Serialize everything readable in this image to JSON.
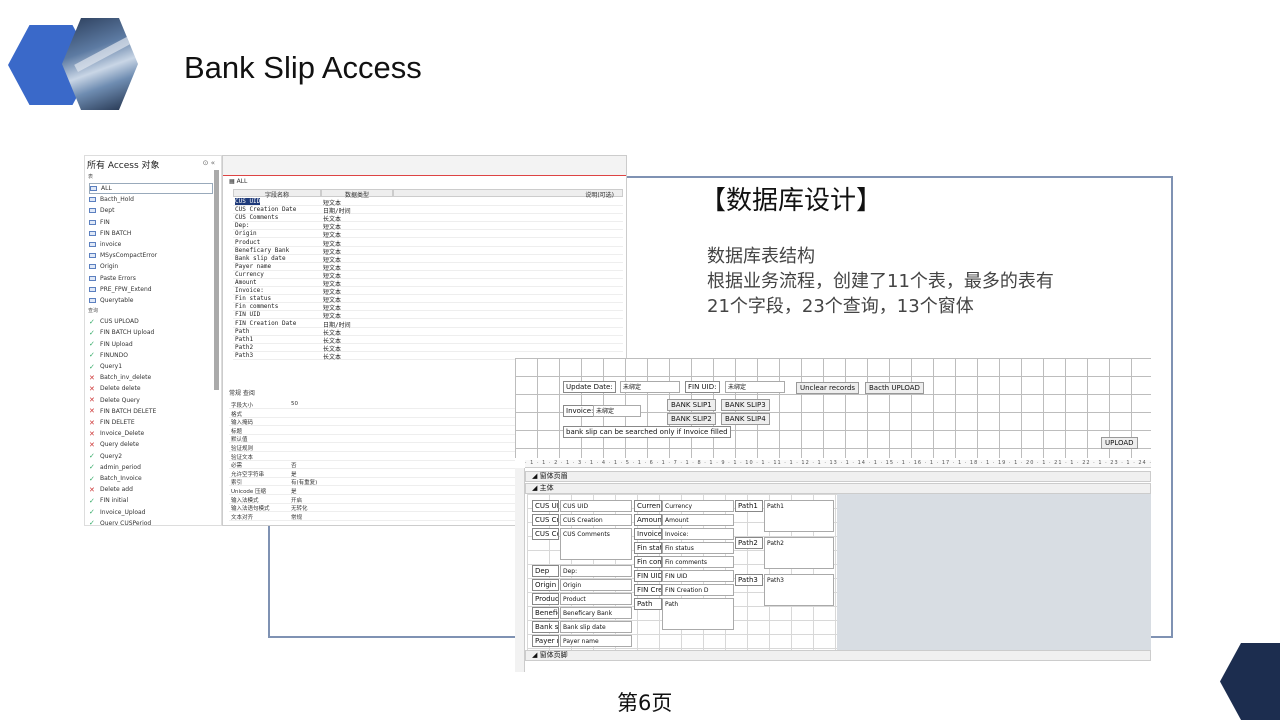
{
  "header": {
    "title": "Bank Slip Access"
  },
  "content": {
    "heading": "【数据库设计】",
    "desc_line1": "数据库表结构",
    "desc_line2": "根据业务流程，创建了11个表，最多的表有",
    "desc_line3": "21个字段，23个查询，13个窗体"
  },
  "nav": {
    "title": "所有 Access 对象",
    "tables_section": "表",
    "queries_section": "查询",
    "tables": [
      "ALL",
      "Bacth_Hold",
      "Dept",
      "FIN",
      "FIN BATCH",
      "invoice",
      "MSysCompactError",
      "Origin",
      "Paste Errors",
      "PRE_FPW_Extend",
      "Querytable"
    ],
    "queries": [
      "CUS UPLOAD",
      "FIN BATCH Upload",
      "FIN Upload",
      "FINUNDO",
      "Query1",
      "Batch_inv_delete",
      "Delete delete",
      "Delete Query",
      "FIN BATCH DELETE",
      "FIN DELETE",
      "Invoice_Delete",
      "Query delete",
      "Query2",
      "admin_period",
      "Batch_Invoice",
      "Delete add",
      "FIN initial",
      "Invoice_Upload",
      "Query CUSPeriod"
    ]
  },
  "table_design": {
    "tab": "ALL",
    "col_field": "字段名称",
    "col_type": "数据类型",
    "col_desc": "说明(可选)",
    "fields": [
      {
        "name": "CUS UID",
        "type": "短文本"
      },
      {
        "name": "CUS Creation Date",
        "type": "日期/时间"
      },
      {
        "name": "CUS Comments",
        "type": "长文本"
      },
      {
        "name": "Dep:",
        "type": "短文本"
      },
      {
        "name": "Origin",
        "type": "短文本"
      },
      {
        "name": "Product",
        "type": "短文本"
      },
      {
        "name": "Beneficary Bank",
        "type": "短文本"
      },
      {
        "name": "Bank slip date",
        "type": "短文本"
      },
      {
        "name": "Payer name",
        "type": "短文本"
      },
      {
        "name": "Currency",
        "type": "短文本"
      },
      {
        "name": "Amount",
        "type": "短文本"
      },
      {
        "name": "Invoice:",
        "type": "短文本"
      },
      {
        "name": "Fin status",
        "type": "短文本"
      },
      {
        "name": "Fin comments",
        "type": "短文本"
      },
      {
        "name": "FIN UID",
        "type": "短文本"
      },
      {
        "name": "FIN Creation Date",
        "type": "日期/时间"
      },
      {
        "name": "Path",
        "type": "长文本"
      },
      {
        "name": "Path1",
        "type": "长文本"
      },
      {
        "name": "Path2",
        "type": "长文本"
      },
      {
        "name": "Path3",
        "type": "长文本"
      }
    ],
    "props_label": "常规  查阅",
    "props": [
      {
        "k": "字段大小",
        "v": "50"
      },
      {
        "k": "格式",
        "v": ""
      },
      {
        "k": "输入掩码",
        "v": ""
      },
      {
        "k": "标题",
        "v": ""
      },
      {
        "k": "默认值",
        "v": ""
      },
      {
        "k": "验证规则",
        "v": ""
      },
      {
        "k": "验证文本",
        "v": ""
      },
      {
        "k": "必需",
        "v": "否"
      },
      {
        "k": "允许空字符串",
        "v": "是"
      },
      {
        "k": "索引",
        "v": "有(有重复)"
      },
      {
        "k": "Unicode 压缩",
        "v": "是"
      },
      {
        "k": "输入法模式",
        "v": "开启"
      },
      {
        "k": "输入法语句模式",
        "v": "无转化"
      },
      {
        "k": "文本对齐",
        "v": "常规"
      }
    ]
  },
  "form_design": {
    "update_date_label": "Update  Date:",
    "update_date_value": "未绑定",
    "fin_uid_label": "FIN UID:",
    "fin_uid_value": "未绑定",
    "unclear_btn": "Unclear records",
    "bacth_upload_btn": "Bacth UPLOAD",
    "invoice_label": "Invoice:",
    "invoice_value": "未绑定",
    "bank_slip1": "BANK SLIP1",
    "bank_slip2": "BANK SLIP2",
    "bank_slip3": "BANK SLIP3",
    "bank_slip4": "BANK SLIP4",
    "note": "bank slip can be searched only if Invoice filled",
    "upload_btn": "UPLOAD",
    "ruler": "· 1 · 1 · 2 · 1 · 3 · 1 · 4 · 1 · 5 · 1 · 6 · 1 · 7 · 1 · 8 · 1 · 9 · 1 · 10 · 1 · 11 · 1 · 12 · 1 · 13 · 1 · 14 · 1 · 15 · 1 · 16 · 1 · 17 · 1 · 18 · 1 · 19 · 1 · 20 · 1 · 21 · 1 · 22 · 1 · 23 · 1 · 24 · 1 · 25 · 1 · 26 · 1 · 27 · 1 · 28",
    "header_section": "窗体页眉",
    "main_section": "主体",
    "footer_section": "窗体页脚",
    "col1": [
      {
        "lbl": "CUS UID",
        "txt": "CUS UID"
      },
      {
        "lbl": "CUS Cre",
        "txt": "CUS Creation"
      },
      {
        "lbl": "CUS Com",
        "txt": "CUS Comments"
      },
      {
        "lbl": "Dep",
        "txt": "Dep:"
      },
      {
        "lbl": "Origin",
        "txt": "Origin"
      },
      {
        "lbl": "Product",
        "txt": "Product"
      },
      {
        "lbl": "Benefica",
        "txt": "Beneficary Bank"
      },
      {
        "lbl": "Bank slip",
        "txt": "Bank slip date"
      },
      {
        "lbl": "Payer na",
        "txt": "Payer name"
      }
    ],
    "col2": [
      {
        "lbl": "Currency",
        "txt": "Currency"
      },
      {
        "lbl": "Amount",
        "txt": "Amount"
      },
      {
        "lbl": "Invoice:",
        "txt": "Invoice:"
      },
      {
        "lbl": "Fin statu",
        "txt": "Fin status"
      },
      {
        "lbl": "Fin comm",
        "txt": "Fin comments"
      },
      {
        "lbl": "FIN UID",
        "txt": "FIN UID"
      },
      {
        "lbl": "FIN Crea",
        "txt": "FIN Creation D"
      },
      {
        "lbl": "Path",
        "txt": "Path"
      }
    ],
    "col3": [
      {
        "lbl": "Path1",
        "txt": "Path1"
      },
      {
        "lbl": "Path2",
        "txt": "Path2"
      },
      {
        "lbl": "Path3",
        "txt": "Path3"
      }
    ]
  },
  "footer": {
    "page": "第6页"
  }
}
